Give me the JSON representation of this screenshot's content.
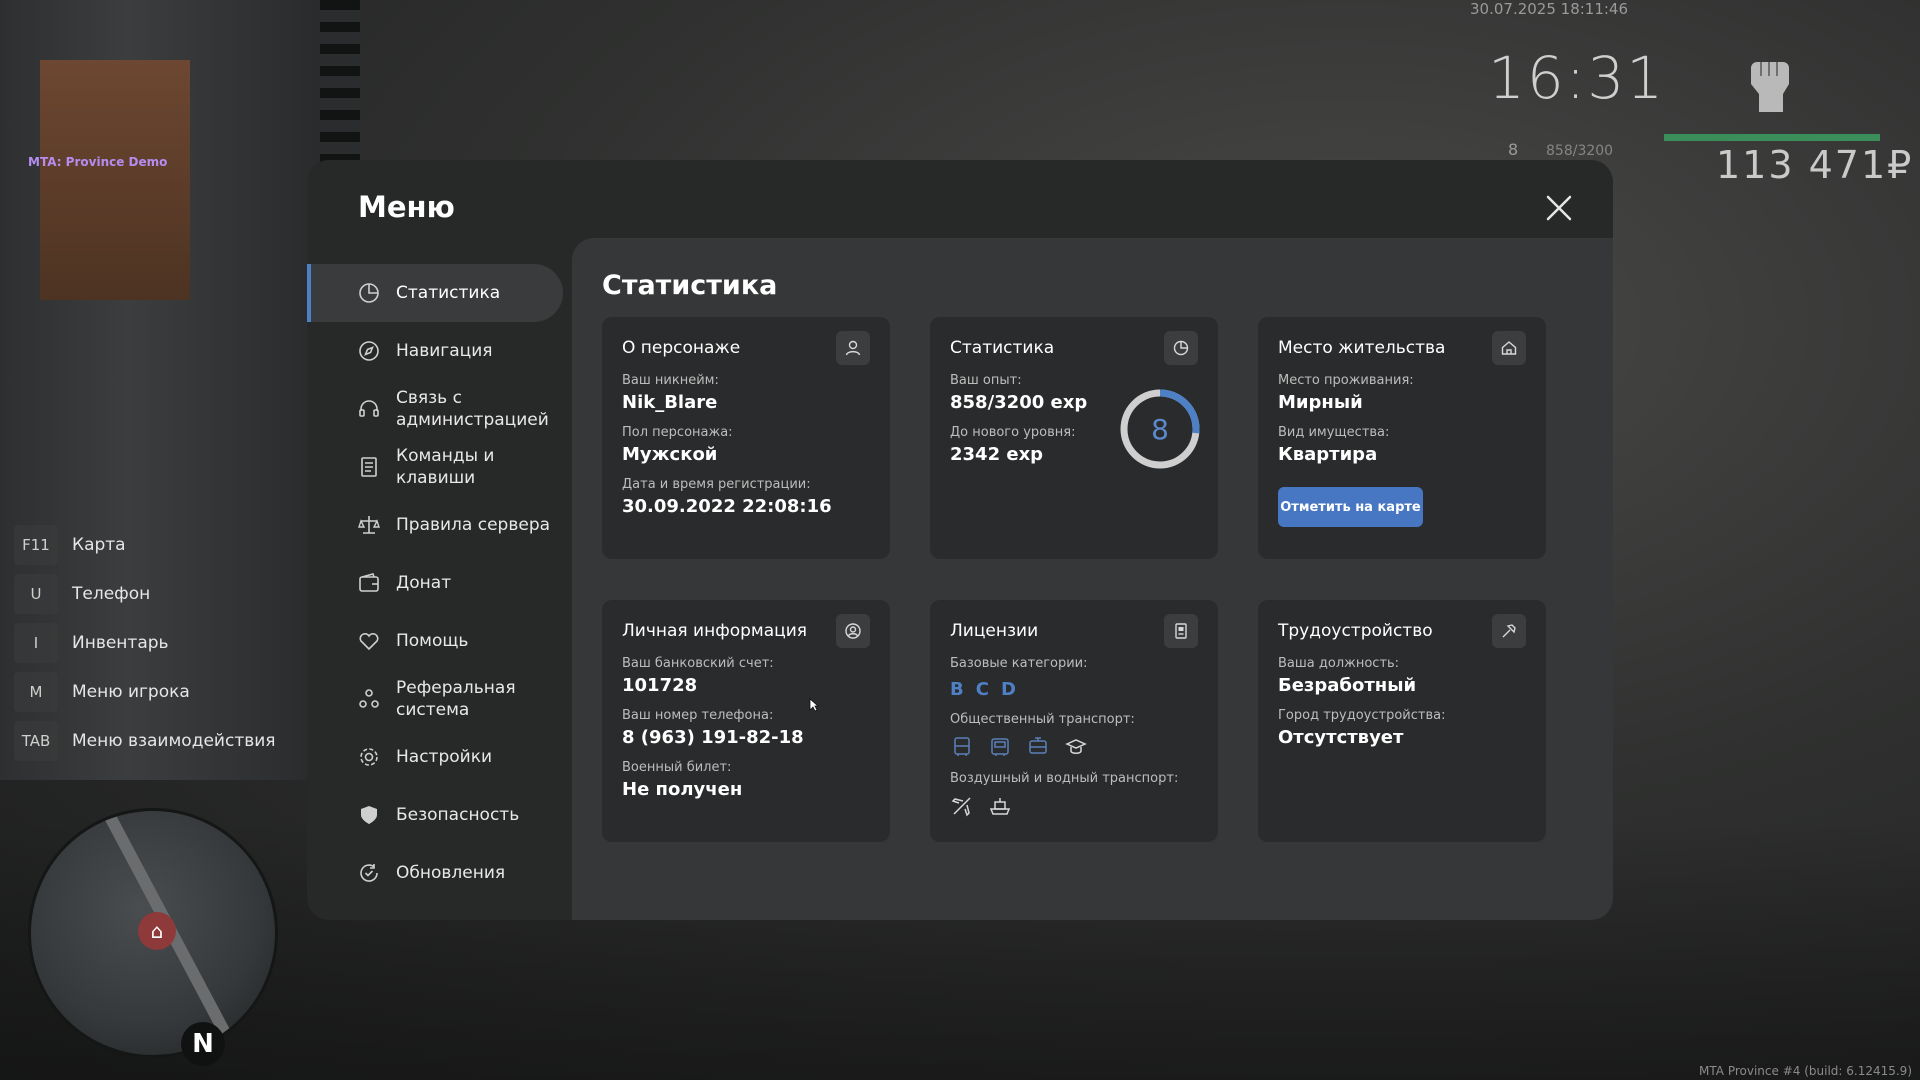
{
  "hud": {
    "server_tag": "MTA: Province Demo",
    "datetime": "30.07.2025 18:11:46",
    "clock": "16:31",
    "level": "8",
    "exp": "858/3200",
    "money": "113 471₽",
    "build": "MTA Province #4 (build: 6.12415.9)",
    "hp_color": "#3b8e5a"
  },
  "hotkeys": [
    {
      "key": "F11",
      "label": "Карта"
    },
    {
      "key": "U",
      "label": "Телефон"
    },
    {
      "key": "I",
      "label": "Инвентарь"
    },
    {
      "key": "M",
      "label": "Меню игрока"
    },
    {
      "key": "TAB",
      "label": "Меню взаимодействия"
    }
  ],
  "radar": {
    "north": "N"
  },
  "modal": {
    "title": "Меню",
    "sidebar": [
      {
        "label": "Статистика",
        "icon": "pie-chart-icon",
        "active": true
      },
      {
        "label": "Навигация",
        "icon": "compass-icon",
        "active": false
      },
      {
        "label": "Связь с администрацией",
        "icon": "headset-icon",
        "active": false
      },
      {
        "label": "Команды и клавиши",
        "icon": "document-icon",
        "active": false
      },
      {
        "label": "Правила сервера",
        "icon": "scales-icon",
        "active": false
      },
      {
        "label": "Донат",
        "icon": "wallet-icon",
        "active": false
      },
      {
        "label": "Помощь",
        "icon": "heart-hand-icon",
        "active": false
      },
      {
        "label": "Реферальная система",
        "icon": "users-icon",
        "active": false
      },
      {
        "label": "Настройки",
        "icon": "gear-icon",
        "active": false
      },
      {
        "label": "Безопасность",
        "icon": "shield-icon",
        "active": false
      },
      {
        "label": "Обновления",
        "icon": "refresh-icon",
        "active": false
      }
    ],
    "content_title": "Статистика",
    "accent": "#4e80c5"
  },
  "cards": {
    "character": {
      "title": "О персонаже",
      "nickname_label": "Ваш никнейм:",
      "nickname": "Nik_Blare",
      "gender_label": "Пол персонажа:",
      "gender": "Мужской",
      "reg_label": "Дата и время регистрации:",
      "reg": "30.09.2022 22:08:16"
    },
    "stats": {
      "title": "Статистика",
      "exp_label": "Ваш опыт:",
      "exp": "858/3200 exp",
      "next_label": "До нового уровня:",
      "next": "2342 exp",
      "level": "8",
      "progress": 0.268
    },
    "residence": {
      "title": "Место жительства",
      "place_label": "Место проживания:",
      "place": "Мирный",
      "type_label": "Вид имущества:",
      "type": "Квартира",
      "button": "Отметить на карте"
    },
    "personal": {
      "title": "Личная информация",
      "bank_label": "Ваш банковский счет:",
      "bank": "101728",
      "phone_label": "Ваш номер телефона:",
      "phone": "8 (963) 191-82-18",
      "military_label": "Военный билет:",
      "military": "Не получен"
    },
    "licenses": {
      "title": "Лицензии",
      "base_label": "Базовые категории:",
      "categories": [
        "B",
        "C",
        "D"
      ],
      "public_label": "Общественный транспорт:",
      "air_label": "Воздушный и водный транспорт:"
    },
    "job": {
      "title": "Трудоустройство",
      "position_label": "Ваша должность:",
      "position": "Безработный",
      "city_label": "Город трудоустройства:",
      "city": "Отсутствует"
    }
  }
}
